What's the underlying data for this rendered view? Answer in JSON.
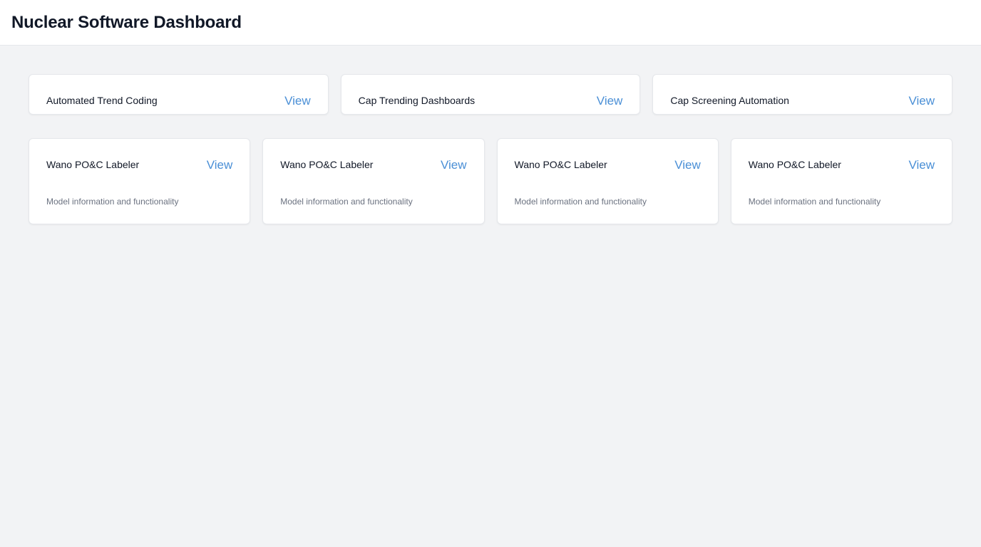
{
  "header": {
    "title": "Nuclear Software Dashboard"
  },
  "top_cards": [
    {
      "title": "Automated Trend Coding",
      "link": "View"
    },
    {
      "title": "Cap Trending Dashboards",
      "link": "View"
    },
    {
      "title": "Cap Screening Automation",
      "link": "View"
    }
  ],
  "bottom_cards": [
    {
      "title": "Wano PO&C Labeler",
      "link": "View",
      "description": "Model information and functionality"
    },
    {
      "title": "Wano PO&C Labeler",
      "link": "View",
      "description": "Model information and functionality"
    },
    {
      "title": "Wano PO&C Labeler",
      "link": "View",
      "description": "Model information and functionality"
    },
    {
      "title": "Wano PO&C Labeler",
      "link": "View",
      "description": "Model information and functionality"
    }
  ],
  "colors": {
    "link": "#4a8fd6",
    "background": "#f2f3f5",
    "card": "#ffffff"
  }
}
